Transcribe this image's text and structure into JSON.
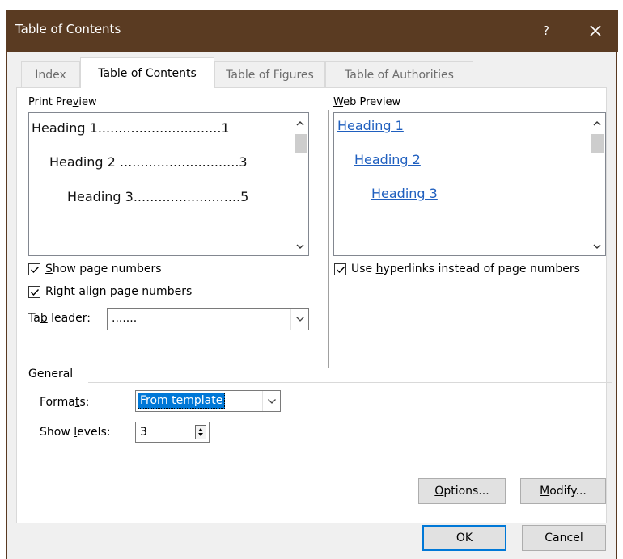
{
  "dialog": {
    "title": "Table of Contents",
    "help_label": "?"
  },
  "tabs": [
    {
      "label": "Index"
    },
    {
      "pre": "Table of ",
      "accel": "C",
      "post": "ontents"
    },
    {
      "label": "Table of Figures"
    },
    {
      "label": "Table of Authorities"
    }
  ],
  "print_preview": {
    "label_pre": "Print Pre",
    "label_accel": "v",
    "label_post": "iew",
    "lines": [
      {
        "text": "Heading 1",
        "dots": "..............................",
        "page": "1"
      },
      {
        "text": "Heading 2",
        "dots": " .............................",
        "page": "3"
      },
      {
        "text": "Heading 3",
        "dots": "..........................",
        "page": "5"
      }
    ]
  },
  "web_preview": {
    "label_accel": "W",
    "label_post": "eb Preview",
    "links": [
      "Heading 1",
      "Heading 2",
      "Heading 3"
    ]
  },
  "options": {
    "show_page_numbers": {
      "accel": "S",
      "post": "how page numbers",
      "checked": true
    },
    "right_align": {
      "accel": "R",
      "post": "ight align page numbers",
      "checked": true
    },
    "tab_leader": {
      "pre": "Ta",
      "accel": "b",
      "post": " leader:",
      "value": "......."
    },
    "use_hyperlinks": {
      "pre": "Use ",
      "accel": "h",
      "post": "yperlinks instead of page numbers",
      "checked": true
    }
  },
  "general": {
    "heading": "General",
    "formats_pre": "Forma",
    "formats_accel": "t",
    "formats_post": "s:",
    "formats_value": "From template",
    "levels_pre": "Show ",
    "levels_accel": "l",
    "levels_post": "evels:",
    "levels_value": "3"
  },
  "buttons": {
    "options_accel": "O",
    "options_post": "ptions...",
    "modify_accel": "M",
    "modify_post": "odify...",
    "ok": "OK",
    "cancel": "Cancel"
  }
}
